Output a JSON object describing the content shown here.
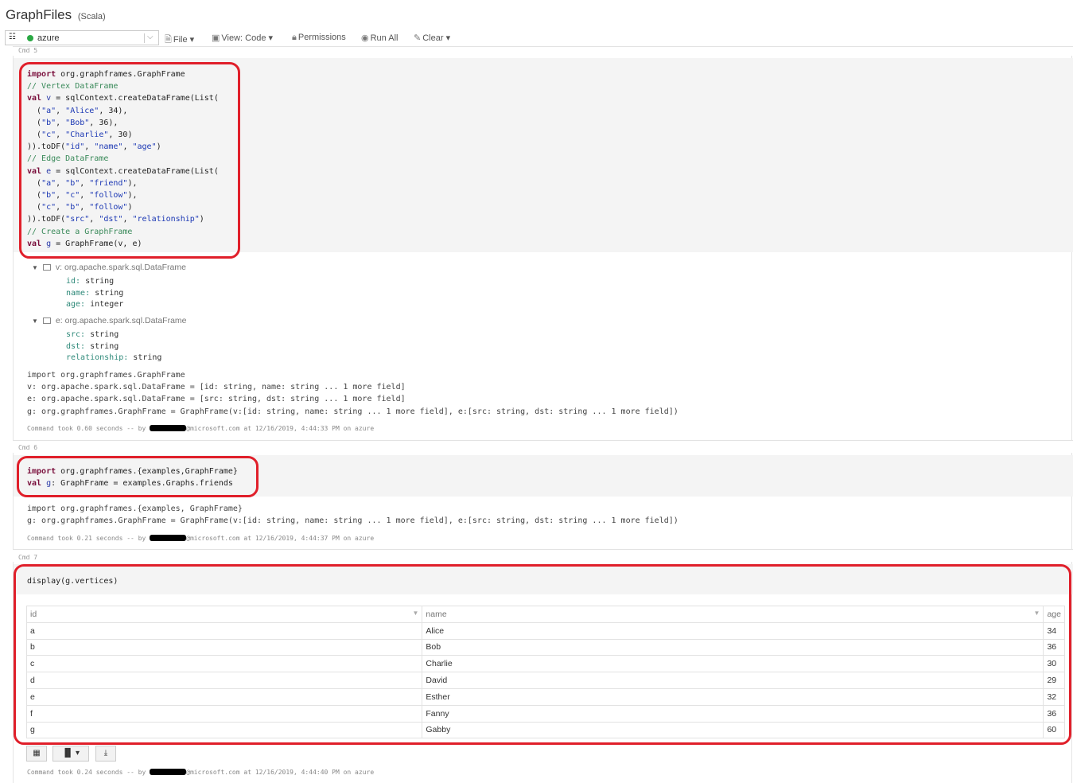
{
  "notebook": {
    "title": "GraphFiles",
    "language": "(Scala)"
  },
  "toolbar": {
    "cluster": "azure",
    "file": "File",
    "view": "View: Code",
    "permissions": "Permissions",
    "run_all": "Run All",
    "clear": "Clear"
  },
  "cells": [
    {
      "label": "Cmd 5",
      "code": [
        [
          [
            "kw",
            "import"
          ],
          [
            "t",
            " org.graphframes.GraphFrame"
          ]
        ],
        [
          [
            "com",
            "// Vertex DataFrame"
          ]
        ],
        [
          [
            "kw",
            "val"
          ],
          [
            "t",
            " "
          ],
          [
            "var",
            "v"
          ],
          [
            "t",
            " = sqlContext.createDataFrame(List("
          ]
        ],
        [
          [
            "t",
            "  ("
          ],
          [
            "str",
            "\"a\""
          ],
          [
            "t",
            ", "
          ],
          [
            "str",
            "\"Alice\""
          ],
          [
            "t",
            ", 34),"
          ]
        ],
        [
          [
            "t",
            "  ("
          ],
          [
            "str",
            "\"b\""
          ],
          [
            "t",
            ", "
          ],
          [
            "str",
            "\"Bob\""
          ],
          [
            "t",
            ", 36),"
          ]
        ],
        [
          [
            "t",
            "  ("
          ],
          [
            "str",
            "\"c\""
          ],
          [
            "t",
            ", "
          ],
          [
            "str",
            "\"Charlie\""
          ],
          [
            "t",
            ", 30)"
          ]
        ],
        [
          [
            "t",
            ")).toDF("
          ],
          [
            "str",
            "\"id\""
          ],
          [
            "t",
            ", "
          ],
          [
            "str",
            "\"name\""
          ],
          [
            "t",
            ", "
          ],
          [
            "str",
            "\"age\""
          ],
          [
            "t",
            ")"
          ]
        ],
        [
          [
            "com",
            "// Edge DataFrame"
          ]
        ],
        [
          [
            "kw",
            "val"
          ],
          [
            "t",
            " "
          ],
          [
            "var",
            "e"
          ],
          [
            "t",
            " = sqlContext.createDataFrame(List("
          ]
        ],
        [
          [
            "t",
            "  ("
          ],
          [
            "str",
            "\"a\""
          ],
          [
            "t",
            ", "
          ],
          [
            "str",
            "\"b\""
          ],
          [
            "t",
            ", "
          ],
          [
            "str",
            "\"friend\""
          ],
          [
            "t",
            "),"
          ]
        ],
        [
          [
            "t",
            "  ("
          ],
          [
            "str",
            "\"b\""
          ],
          [
            "t",
            ", "
          ],
          [
            "str",
            "\"c\""
          ],
          [
            "t",
            ", "
          ],
          [
            "str",
            "\"follow\""
          ],
          [
            "t",
            "),"
          ]
        ],
        [
          [
            "t",
            "  ("
          ],
          [
            "str",
            "\"c\""
          ],
          [
            "t",
            ", "
          ],
          [
            "str",
            "\"b\""
          ],
          [
            "t",
            ", "
          ],
          [
            "str",
            "\"follow\""
          ],
          [
            "t",
            ")"
          ]
        ],
        [
          [
            "t",
            ")).toDF("
          ],
          [
            "str",
            "\"src\""
          ],
          [
            "t",
            ", "
          ],
          [
            "str",
            "\"dst\""
          ],
          [
            "t",
            ", "
          ],
          [
            "str",
            "\"relationship\""
          ],
          [
            "t",
            ")"
          ]
        ],
        [
          [
            "com",
            "// Create a GraphFrame"
          ]
        ],
        [
          [
            "kw",
            "val"
          ],
          [
            "t",
            " "
          ],
          [
            "var",
            "g"
          ],
          [
            "t",
            " = GraphFrame(v, e)"
          ]
        ]
      ],
      "schemas": [
        {
          "var": "v:",
          "type": "org.apache.spark.sql.DataFrame",
          "fields": [
            [
              "id:",
              "string"
            ],
            [
              "name:",
              "string"
            ],
            [
              "age:",
              "integer"
            ]
          ]
        },
        {
          "var": "e:",
          "type": "org.apache.spark.sql.DataFrame",
          "fields": [
            [
              "src:",
              "string"
            ],
            [
              "dst:",
              "string"
            ],
            [
              "relationship:",
              "string"
            ]
          ]
        }
      ],
      "output": [
        "import org.graphframes.GraphFrame",
        "v: org.apache.spark.sql.DataFrame = [id: string, name: string ... 1 more field]",
        "e: org.apache.spark.sql.DataFrame = [src: string, dst: string ... 1 more field]",
        "g: org.graphframes.GraphFrame = GraphFrame(v:[id: string, name: string ... 1 more field], e:[src: string, dst: string ... 1 more field])"
      ],
      "took_prefix": "Command took 0.60 seconds -- by ",
      "took_suffix": "@microsoft.com at 12/16/2019, 4:44:33 PM on azure"
    },
    {
      "label": "Cmd 6",
      "code": [
        [
          [
            "kw",
            "import"
          ],
          [
            "t",
            " org.graphframes.{examples,GraphFrame}"
          ]
        ],
        [
          [
            "kw",
            "val"
          ],
          [
            "t",
            " "
          ],
          [
            "var",
            "g"
          ],
          [
            "t",
            ": GraphFrame = examples.Graphs.friends"
          ]
        ]
      ],
      "output": [
        "import org.graphframes.{examples, GraphFrame}",
        "g: org.graphframes.GraphFrame = GraphFrame(v:[id: string, name: string ... 1 more field], e:[src: string, dst: string ... 1 more field])"
      ],
      "took_prefix": "Command took 0.21 seconds -- by ",
      "took_suffix": "@microsoft.com at 12/16/2019, 4:44:37 PM on azure"
    },
    {
      "label": "Cmd 7",
      "code": [
        [
          [
            "t",
            "display(g.vertices)"
          ]
        ]
      ],
      "table": {
        "columns": [
          "id",
          "name",
          "age"
        ],
        "rows": [
          [
            "a",
            "Alice",
            "34"
          ],
          [
            "b",
            "Bob",
            "36"
          ],
          [
            "c",
            "Charlie",
            "30"
          ],
          [
            "d",
            "David",
            "29"
          ],
          [
            "e",
            "Esther",
            "32"
          ],
          [
            "f",
            "Fanny",
            "36"
          ],
          [
            "g",
            "Gabby",
            "60"
          ]
        ]
      },
      "took_prefix": "Command took 0.24 seconds -- by ",
      "took_suffix": "@microsoft.com at 12/16/2019, 4:44:40 PM on azure"
    }
  ],
  "colors": {
    "highlight": "#e01f2a",
    "cluster_status": "#2aa843"
  }
}
